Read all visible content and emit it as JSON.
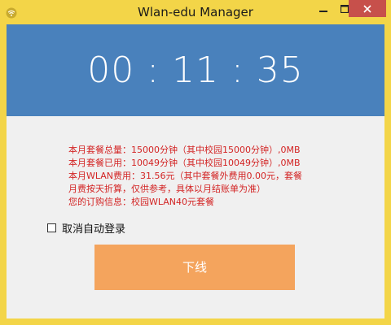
{
  "window": {
    "title": "Wlan-edu Manager",
    "icons": {
      "app": "wifi-icon",
      "minimize": "minimize-icon",
      "maximize": "maximize-icon",
      "close": "close-icon"
    },
    "colors": {
      "frame": "#f3d548",
      "close_button": "#c7504b"
    }
  },
  "timer": {
    "value": "00 : 11 : 35",
    "background": "#4981bc"
  },
  "info": {
    "color": "#d32424",
    "lines": [
      "本月套餐总量：15000分钟（其中校园15000分钟）,0MB",
      "本月套餐已用：10049分钟（其中校园10049分钟）,0MB",
      "本月WLAN费用：31.56元（其中套餐外费用0.00元，套餐",
      "月费按天折算，仅供参考，具体以月结账单为准）",
      "您的订购信息：校园WLAN40元套餐"
    ]
  },
  "auto_login": {
    "label": "取消自动登录",
    "checked": false
  },
  "logout_button": {
    "label": "下线",
    "color": "#f4a45d"
  }
}
